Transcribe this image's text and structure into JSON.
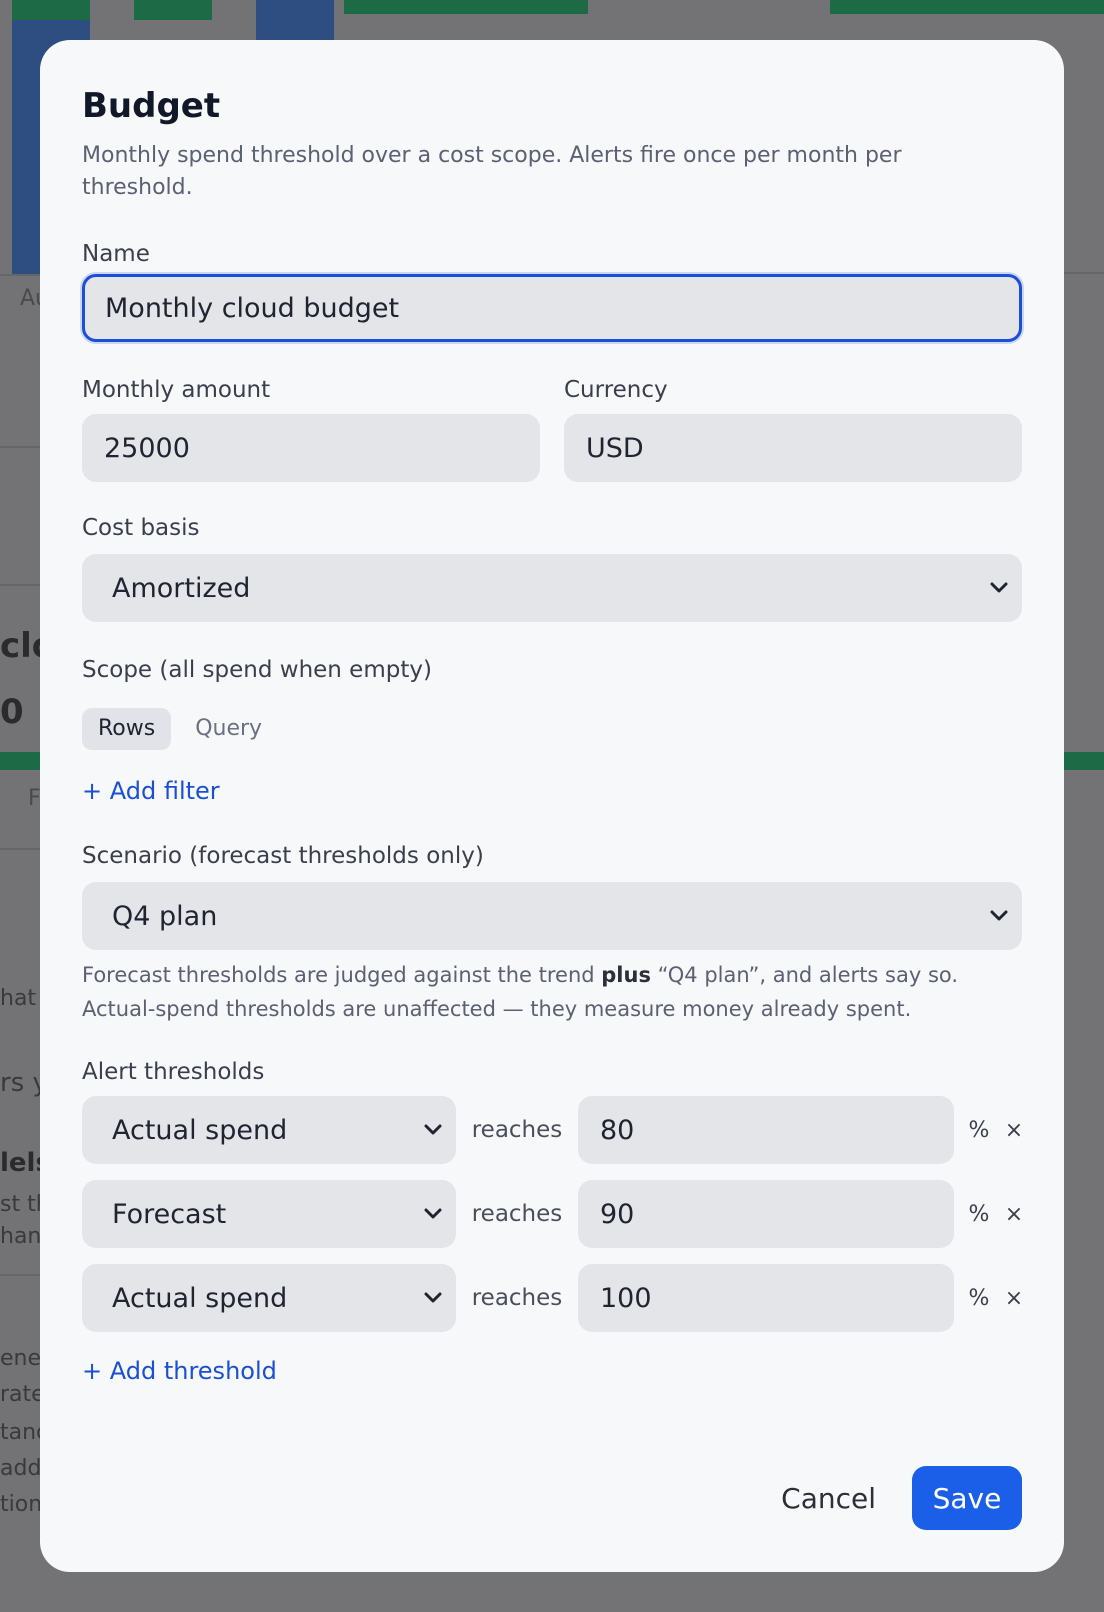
{
  "modal": {
    "title": "Budget",
    "description": "Monthly spend threshold over a cost scope. Alerts fire once per month per threshold."
  },
  "fields": {
    "name_label": "Name",
    "name_value": "Monthly cloud budget",
    "amount_label": "Monthly amount",
    "amount_value": "25000",
    "currency_label": "Currency",
    "currency_value": "USD",
    "cost_basis_label": "Cost basis",
    "cost_basis_value": "Amortized",
    "scope_label": "Scope (all spend when empty)",
    "scope_tabs": [
      "Rows",
      "Query"
    ],
    "add_filter": "+ Add filter",
    "scenario_label": "Scenario (forecast thresholds only)",
    "scenario_value": "Q4 plan",
    "scenario_help_pre": "Forecast thresholds are judged against the trend ",
    "scenario_help_bold": "plus",
    "scenario_help_post": " “Q4 plan”, and alerts say so. Actual-spend thresholds are unaffected — they measure money already spent."
  },
  "thresholds": {
    "label": "Alert thresholds",
    "connector": "reaches",
    "unit": "%",
    "remove_glyph": "×",
    "rows": [
      {
        "type": "Actual spend",
        "value": "80"
      },
      {
        "type": "Forecast",
        "value": "90"
      },
      {
        "type": "Actual spend",
        "value": "100"
      }
    ],
    "add": "+ Add threshold"
  },
  "footer": {
    "cancel": "Cancel",
    "save": "Save"
  },
  "background": {
    "fragments": [
      "Au",
      "clo",
      "0",
      "F",
      "hat g",
      "rs y",
      "lels",
      "st th",
      "han",
      "ene",
      "rate",
      "tanc",
      "add",
      "tion"
    ]
  },
  "colors": {
    "accent": "#1b5fe8",
    "link": "#1a4fd6",
    "bg_green": "#1d7a4e",
    "bg_blue": "#2b4f86"
  }
}
